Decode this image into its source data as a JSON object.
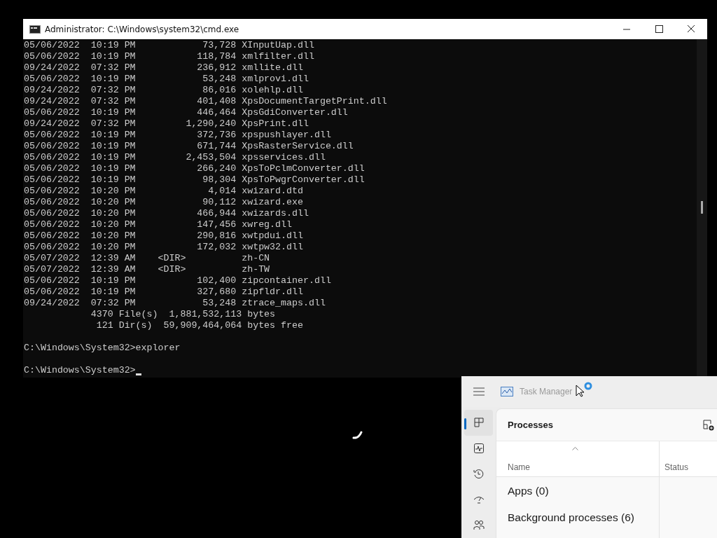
{
  "cmd_window": {
    "title": "Administrator: C:\\Windows\\system32\\cmd.exe",
    "listing": [
      "05/06/2022  10:19 PM            73,728 XInputUap.dll",
      "05/06/2022  10:19 PM           118,784 xmlfilter.dll",
      "09/24/2022  07:32 PM           236,912 xmllite.dll",
      "05/06/2022  10:19 PM            53,248 xmlprovi.dll",
      "09/24/2022  07:32 PM            86,016 xolehlp.dll",
      "09/24/2022  07:32 PM           401,408 XpsDocumentTargetPrint.dll",
      "05/06/2022  10:19 PM           446,464 XpsGdiConverter.dll",
      "09/24/2022  07:32 PM         1,290,240 XpsPrint.dll",
      "05/06/2022  10:19 PM           372,736 xpspushlayer.dll",
      "05/06/2022  10:19 PM           671,744 XpsRasterService.dll",
      "05/06/2022  10:19 PM         2,453,504 xpsservices.dll",
      "05/06/2022  10:19 PM           266,240 XpsToPclmConverter.dll",
      "05/06/2022  10:19 PM            98,304 XpsToPwgrConverter.dll",
      "05/06/2022  10:20 PM             4,014 xwizard.dtd",
      "05/06/2022  10:20 PM            90,112 xwizard.exe",
      "05/06/2022  10:20 PM           466,944 xwizards.dll",
      "05/06/2022  10:20 PM           147,456 xwreg.dll",
      "05/06/2022  10:20 PM           290,816 xwtpdui.dll",
      "05/06/2022  10:20 PM           172,032 xwtpw32.dll",
      "05/07/2022  12:39 AM    <DIR>          zh-CN",
      "05/07/2022  12:39 AM    <DIR>          zh-TW",
      "05/06/2022  10:19 PM           102,400 zipcontainer.dll",
      "05/06/2022  10:19 PM           327,680 zipfldr.dll",
      "09/24/2022  07:32 PM            53,248 ztrace_maps.dll"
    ],
    "summary": [
      "            4370 File(s)  1,881,532,113 bytes",
      "             121 Dir(s)  59,909,464,064 bytes free"
    ],
    "commands": [
      {
        "prompt": "C:\\Windows\\System32>",
        "input": "explorer",
        "cursor": false
      },
      {
        "prompt": "C:\\Windows\\System32>",
        "cursor": true
      }
    ]
  },
  "task_manager": {
    "title": "Task Manager",
    "nav": [
      {
        "kind": "processes",
        "selected": true
      },
      {
        "kind": "performance",
        "selected": false
      },
      {
        "kind": "history",
        "selected": false
      },
      {
        "kind": "startup",
        "selected": false
      },
      {
        "kind": "users",
        "selected": false
      }
    ],
    "heading": "Processes",
    "columns": [
      "Name",
      "Status"
    ],
    "groups": [
      "Apps (0)",
      "Background processes (6)"
    ]
  }
}
